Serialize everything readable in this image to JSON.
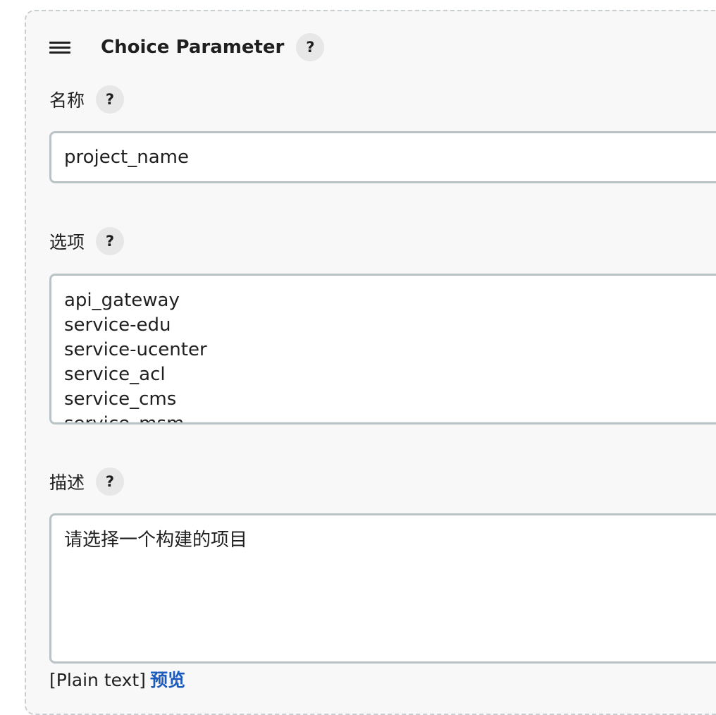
{
  "section": {
    "title": "Choice Parameter",
    "help": "?"
  },
  "name_field": {
    "label": "名称",
    "help": "?",
    "value": "project_name"
  },
  "choices_field": {
    "label": "选项",
    "help": "?",
    "lines": [
      "api_gateway",
      "service-edu",
      "service-ucenter",
      "service_acl",
      "service_cms",
      "service_msm"
    ]
  },
  "description_field": {
    "label": "描述",
    "help": "?",
    "value": "请选择一个构建的项目"
  },
  "footer": {
    "format": "[Plain text]",
    "preview_link": "预览"
  }
}
